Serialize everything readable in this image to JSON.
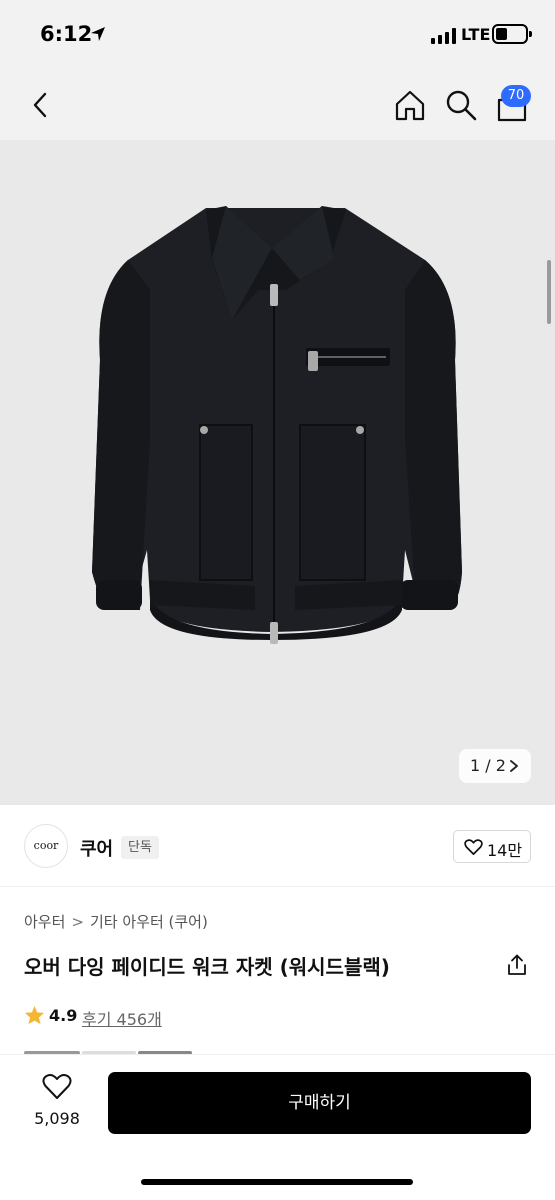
{
  "status_bar": {
    "time": "6:12",
    "network": "LTE",
    "icons": [
      "location-arrow-icon",
      "signal-icon",
      "battery-icon"
    ]
  },
  "nav": {
    "back_icon": "chevron-left-icon",
    "home_icon": "home-icon",
    "search_icon": "search-icon",
    "cart_icon": "shopping-bag-icon",
    "cart_badge": "70",
    "badge_color": "#2f6bff"
  },
  "gallery": {
    "current": "1",
    "total": "2",
    "pager_text": "1 / 2",
    "image_subject": "black work jacket",
    "background_color": "#e9e9e9"
  },
  "brand": {
    "logo_text": "coor",
    "name": "쿠어",
    "tag": "단독",
    "like_count": "14만",
    "like_icon": "heart-outline-icon"
  },
  "product": {
    "breadcrumb": [
      "아우터",
      "기타 아우터 (쿠어)"
    ],
    "title": "오버 다잉 페이디드 워크 자켓 (워시드블랙)",
    "share_icon": "share-icon",
    "rating": "4.9",
    "reviews_label": "후기 456개",
    "star_color": "#f5b731"
  },
  "bottom_bar": {
    "wish_count": "5,098",
    "wish_icon": "heart-outline-icon",
    "buy_label": "구매하기",
    "buy_color": "#000000"
  }
}
